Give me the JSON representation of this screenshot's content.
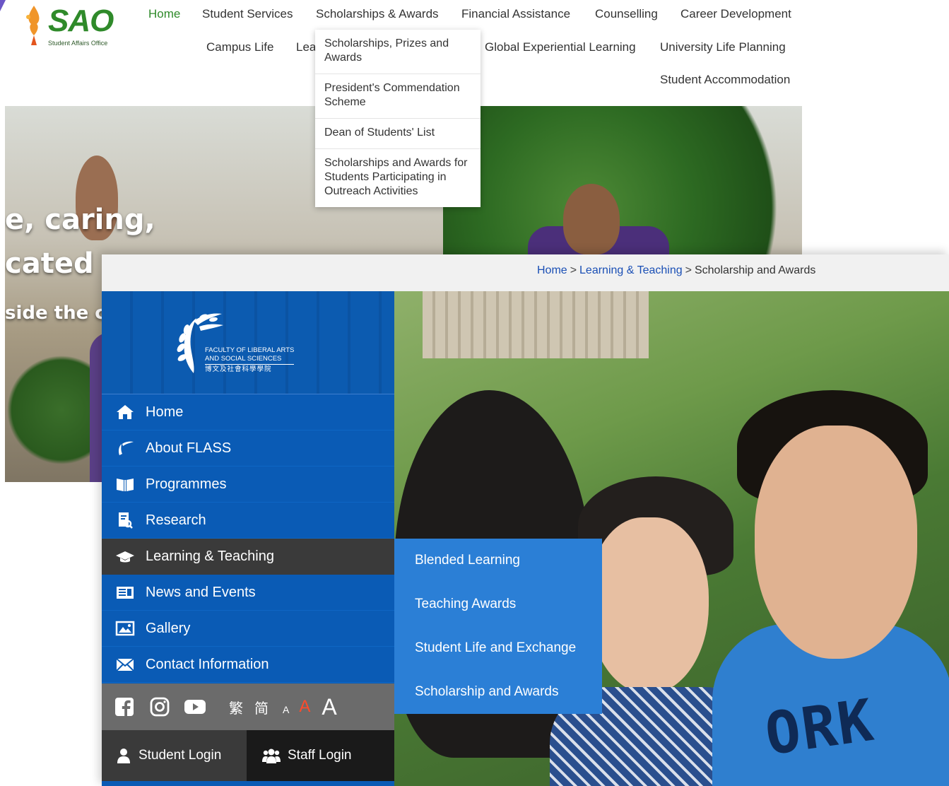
{
  "sao": {
    "logo": {
      "wordmark": "SAO",
      "subtitle": "Student Affairs Office"
    },
    "nav_row1": [
      "Home",
      "Student Services",
      "Scholarships & Awards",
      "Financial Assistance",
      "Counselling",
      "Career Development"
    ],
    "nav_row2": [
      "Campus Life",
      "Lea",
      "Global Experiential Learning",
      "University Life Planning"
    ],
    "nav_row3": [
      "Student Accommodation"
    ],
    "dropdown": [
      "Scholarships, Prizes and Awards",
      "President's Commendation Scheme",
      "Dean of Students' List",
      "Scholarships and Awards for Students Participating in Outreach Activities"
    ],
    "hero_lines": [
      "e, caring,",
      "cated pr",
      "side the clas"
    ]
  },
  "flass": {
    "breadcrumb": {
      "home": "Home",
      "sep": ">",
      "section": "Learning & Teaching",
      "current": "Scholarship and Awards"
    },
    "logo": {
      "line1": "FACULTY OF LIBERAL ARTS",
      "line2": "AND SOCIAL SCIENCES",
      "line3": "博文及社會科學學院"
    },
    "menu": [
      {
        "label": "Home",
        "icon": "home-icon"
      },
      {
        "label": "About FLASS",
        "icon": "wreath-icon"
      },
      {
        "label": "Programmes",
        "icon": "book-icon"
      },
      {
        "label": "Research",
        "icon": "research-icon"
      },
      {
        "label": "Learning & Teaching",
        "icon": "graduation-cap-icon"
      },
      {
        "label": "News and Events",
        "icon": "newspaper-icon"
      },
      {
        "label": "Gallery",
        "icon": "gallery-icon"
      },
      {
        "label": "Contact Information",
        "icon": "envelope-icon"
      }
    ],
    "utility": {
      "lang_trad": "繁",
      "lang_simp": "简",
      "font_small": "A",
      "font_mid": "A",
      "font_big": "A"
    },
    "login": {
      "student": "Student Login",
      "staff": "Staff Login"
    },
    "submenu": [
      "Blended Learning",
      "Teaching Awards",
      "Student Life and Exchange",
      "Scholarship and Awards"
    ],
    "photo_shirt_text": "ORK"
  },
  "colors": {
    "sao_green": "#2f8a2a",
    "flass_blue": "#0a5bb5",
    "submenu_blue": "#2b7fd6",
    "active_dark": "#3a3a3a",
    "font_mid_red": "#ff4b2b",
    "breadcrumb_link": "#1a4fb5"
  }
}
